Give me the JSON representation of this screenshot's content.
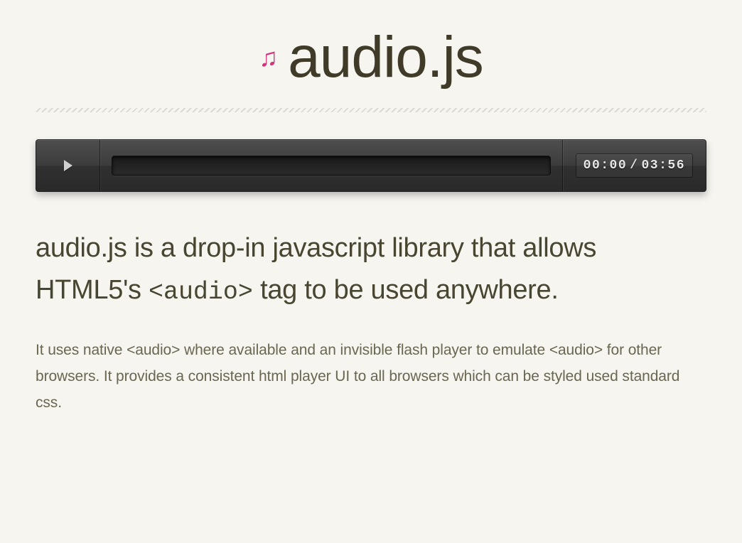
{
  "header": {
    "title": "audio.js"
  },
  "player": {
    "time_current": "00:00",
    "time_separator": "/",
    "time_total": "03:56"
  },
  "content": {
    "lead_1": "audio.js is a drop-in javascript library that allows HTML5's ",
    "lead_code": "<audio>",
    "lead_2": " tag to be used anywhere.",
    "body_1": "It uses native ",
    "body_code_1": "<audio>",
    "body_2": " where available and an invisible flash player to emulate ",
    "body_code_2": "<audio>",
    "body_3": " for other browsers. It provides a consistent html player UI to all browsers which can be styled used standard css."
  }
}
